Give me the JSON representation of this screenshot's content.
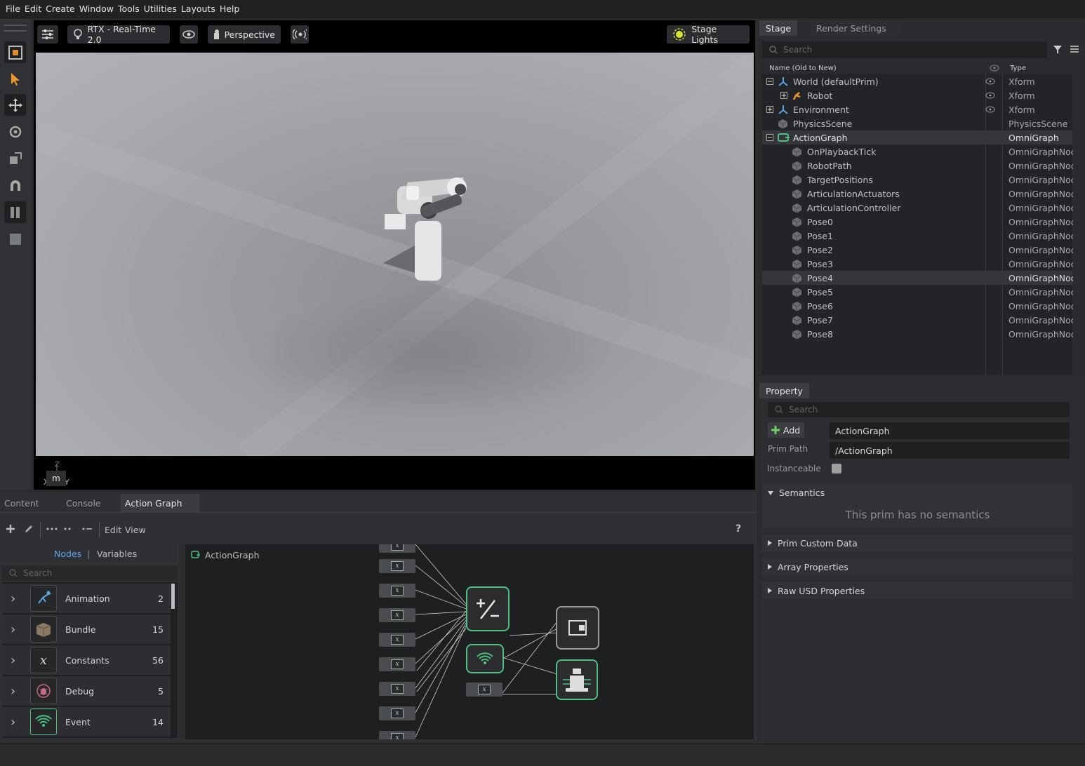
{
  "menu": [
    "File",
    "Edit",
    "Create",
    "Window",
    "Tools",
    "Utilities",
    "Layouts",
    "Help"
  ],
  "viewport": {
    "renderer": "RTX - Real-Time 2.0",
    "camera": "Perspective",
    "stage_lights": "Stage Lights",
    "units": "m",
    "axis_x": "X",
    "axis_y": "Y",
    "axis_z": "Z"
  },
  "stage": {
    "tabs": [
      "Stage",
      "Render Settings"
    ],
    "search_placeholder": "Search",
    "col_name": "Name (Old to New)",
    "col_type": "Type",
    "rows": [
      {
        "name": "World (defaultPrim)",
        "type": "Xform"
      },
      {
        "name": "Robot",
        "type": "Xform"
      },
      {
        "name": "Environment",
        "type": "Xform"
      },
      {
        "name": "PhysicsScene",
        "type": "PhysicsScene"
      },
      {
        "name": "ActionGraph",
        "type": "OmniGraph"
      },
      {
        "name": "OnPlaybackTick",
        "type": "OmniGraphNode"
      },
      {
        "name": "RobotPath",
        "type": "OmniGraphNode"
      },
      {
        "name": "TargetPositions",
        "type": "OmniGraphNode"
      },
      {
        "name": "ArticulationActuators",
        "type": "OmniGraphNode"
      },
      {
        "name": "ArticulationController",
        "type": "OmniGraphNode"
      },
      {
        "name": "Pose0",
        "type": "OmniGraphNode"
      },
      {
        "name": "Pose1",
        "type": "OmniGraphNode"
      },
      {
        "name": "Pose2",
        "type": "OmniGraphNode"
      },
      {
        "name": "Pose3",
        "type": "OmniGraphNode"
      },
      {
        "name": "Pose4",
        "type": "OmniGraphNode"
      },
      {
        "name": "Pose5",
        "type": "OmniGraphNode"
      },
      {
        "name": "Pose6",
        "type": "OmniGraphNode"
      },
      {
        "name": "Pose7",
        "type": "OmniGraphNode"
      },
      {
        "name": "Pose8",
        "type": "OmniGraphNode"
      }
    ]
  },
  "property": {
    "tab": "Property",
    "search_placeholder": "Search",
    "add_label": "Add",
    "prim_name": "ActionGraph",
    "prim_path_label": "Prim Path",
    "prim_path": "/ActionGraph",
    "instanceable_label": "Instanceable",
    "semantics_label": "Semantics",
    "semantics_empty": "This prim has no semantics",
    "sections": [
      "Prim Custom Data",
      "Array Properties",
      "Raw USD Properties"
    ]
  },
  "bottom": {
    "tabs": [
      "Content",
      "Console",
      "Action Graph"
    ],
    "menu_edit": "Edit",
    "menu_view": "View",
    "help": "?",
    "nodes_tab": "Nodes",
    "variables_tab": "Variables",
    "search_placeholder": "Search",
    "graph_name": "ActionGraph",
    "categories": [
      {
        "label": "Animation",
        "count": "2"
      },
      {
        "label": "Bundle",
        "count": "15"
      },
      {
        "label": "Constants",
        "count": "56"
      },
      {
        "label": "Debug",
        "count": "5"
      },
      {
        "label": "Event",
        "count": "14"
      }
    ]
  },
  "colors": {
    "accent_green": "#6fce6a",
    "link_blue": "#5ba6e6",
    "panel_bg": "#2a2b2e"
  }
}
